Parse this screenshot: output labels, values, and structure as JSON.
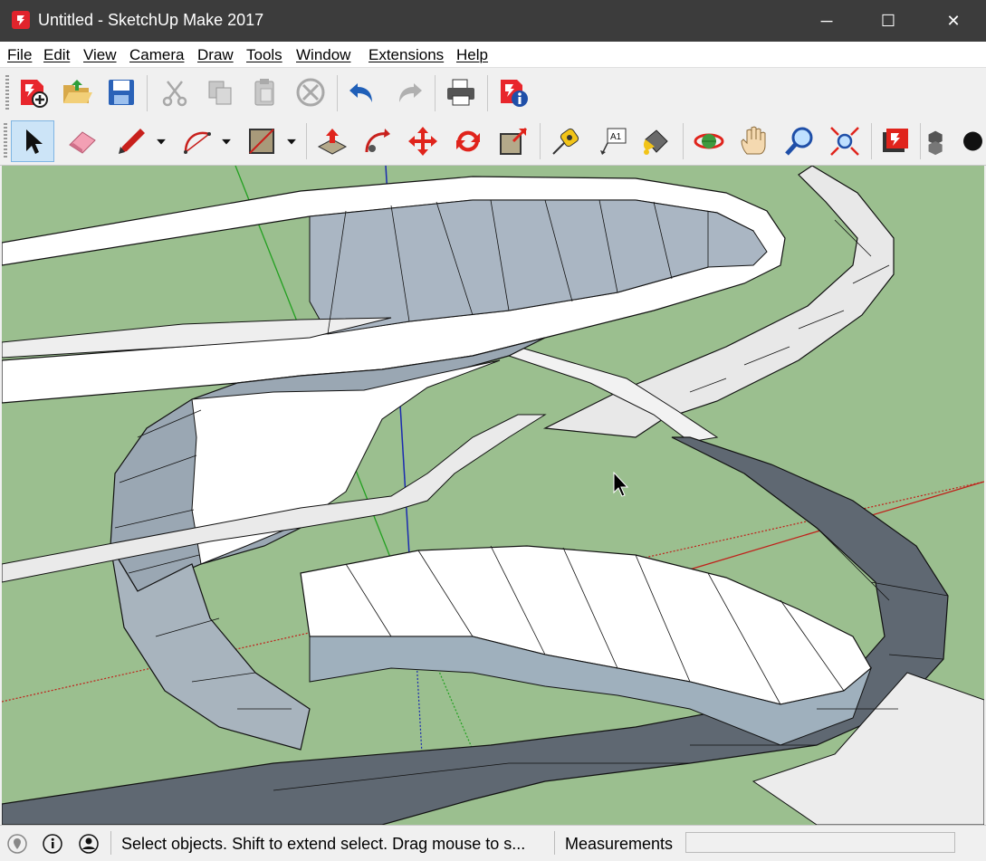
{
  "window": {
    "title": "Untitled - SketchUp Make 2017",
    "controls": {
      "minimize": "─",
      "maximize": "☐",
      "close": "✕"
    }
  },
  "menu": {
    "items": [
      {
        "label": "File"
      },
      {
        "label": "Edit"
      },
      {
        "label": "View"
      },
      {
        "label": "Camera"
      },
      {
        "label": "Draw"
      },
      {
        "label": "Tools"
      },
      {
        "label": "Window"
      },
      {
        "label": "Extensions"
      },
      {
        "label": "Help"
      }
    ]
  },
  "toolbar_standard": {
    "tools": [
      {
        "name": "new-model",
        "icon": "new-file-icon",
        "enabled": true
      },
      {
        "name": "open",
        "icon": "open-folder-icon",
        "enabled": true
      },
      {
        "name": "save",
        "icon": "floppy-icon",
        "enabled": true
      },
      {
        "name": "cut",
        "icon": "scissors-icon",
        "enabled": false
      },
      {
        "name": "copy",
        "icon": "copy-icon",
        "enabled": false
      },
      {
        "name": "paste",
        "icon": "paste-icon",
        "enabled": false
      },
      {
        "name": "erase",
        "icon": "erase-circle-icon",
        "enabled": false
      },
      {
        "name": "undo",
        "icon": "undo-icon",
        "enabled": true
      },
      {
        "name": "redo",
        "icon": "redo-icon",
        "enabled": false
      },
      {
        "name": "print",
        "icon": "printer-icon",
        "enabled": true
      },
      {
        "name": "model-info",
        "icon": "model-info-icon",
        "enabled": true
      }
    ]
  },
  "toolbar_large": {
    "tools": [
      {
        "name": "select",
        "icon": "arrow-cursor-icon",
        "active": true
      },
      {
        "name": "eraser",
        "icon": "eraser-icon"
      },
      {
        "name": "line",
        "icon": "pencil-icon"
      },
      {
        "name": "arc",
        "icon": "arc-icon"
      },
      {
        "name": "rectangle",
        "icon": "rectangle-icon"
      },
      {
        "name": "push-pull",
        "icon": "push-pull-icon"
      },
      {
        "name": "follow-me",
        "icon": "follow-me-icon"
      },
      {
        "name": "move",
        "icon": "move-icon"
      },
      {
        "name": "rotate",
        "icon": "rotate-icon"
      },
      {
        "name": "scale",
        "icon": "scale-icon"
      },
      {
        "name": "tape-measure",
        "icon": "tape-measure-icon"
      },
      {
        "name": "text",
        "icon": "text-label-icon",
        "text": "A1"
      },
      {
        "name": "paint-bucket",
        "icon": "paint-bucket-icon"
      },
      {
        "name": "orbit",
        "icon": "orbit-icon"
      },
      {
        "name": "pan",
        "icon": "hand-icon"
      },
      {
        "name": "zoom",
        "icon": "magnifier-icon"
      },
      {
        "name": "zoom-extents",
        "icon": "zoom-extents-icon"
      },
      {
        "name": "warehouse",
        "icon": "warehouse-icon"
      },
      {
        "name": "components",
        "icon": "components-icon"
      },
      {
        "name": "styles",
        "icon": "styles-icon"
      }
    ]
  },
  "viewport": {
    "background": "#9bbf8f",
    "axis_colors": {
      "red": "#c0201a",
      "green": "#22a020",
      "blue": "#1a2ab0"
    }
  },
  "statusbar": {
    "message": "Select objects. Shift to extend select. Drag mouse to s...",
    "measurements_label": "Measurements",
    "measurements_value": ""
  }
}
